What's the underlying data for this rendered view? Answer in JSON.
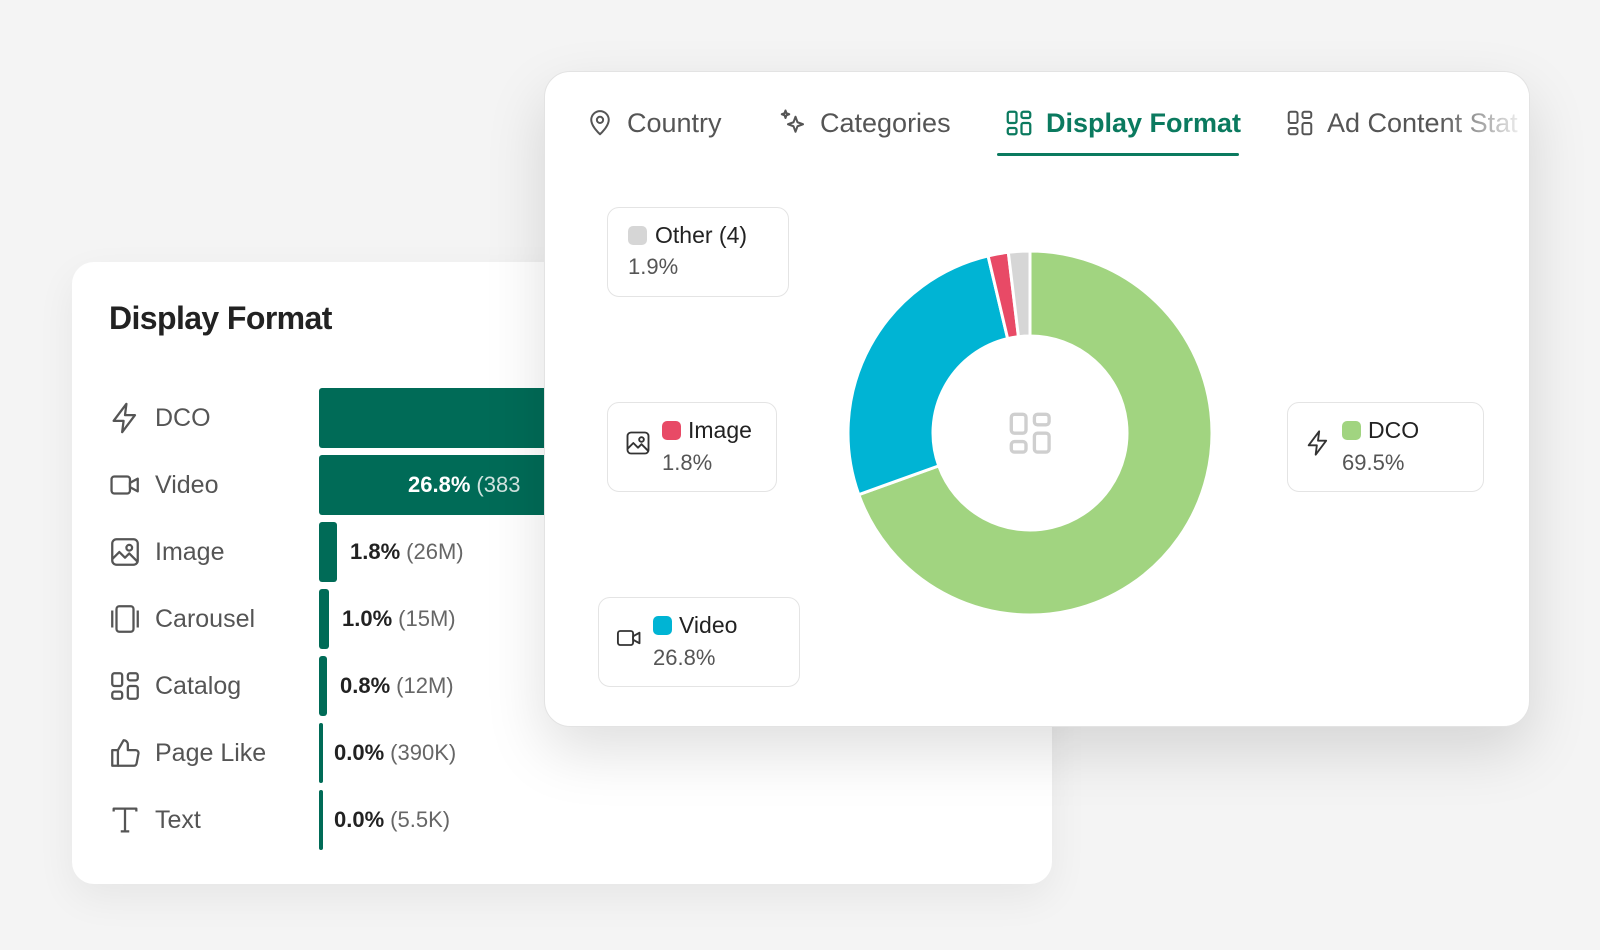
{
  "back_card": {
    "title": "Display Format"
  },
  "front_card": {
    "tabs": [
      {
        "label": "Country",
        "icon": "map-pin-icon",
        "active": false
      },
      {
        "label": "Categories",
        "icon": "sparkles-icon",
        "active": false
      },
      {
        "label": "Display Format",
        "icon": "layout-grid-icon",
        "active": true
      },
      {
        "label": "Ad Content Stat",
        "icon": "layout-grid-icon",
        "active": false
      }
    ]
  },
  "colors": {
    "accent": "#0b7a5f",
    "bar": "#006b57",
    "dco": "#a1d480",
    "video": "#00b4d4",
    "image": "#e84a66",
    "other": "#d6d6d6"
  },
  "chart_data": [
    {
      "type": "bar",
      "orientation": "horizontal",
      "title": "Display Format",
      "categories": [
        "DCO",
        "Video",
        "Image",
        "Carousel",
        "Catalog",
        "Page Like",
        "Text"
      ],
      "values": [
        69.5,
        26.8,
        1.8,
        1.0,
        0.8,
        0.0,
        0.0
      ],
      "pct_labels": [
        "",
        "26.8%",
        "1.8%",
        "1.0%",
        "0.8%",
        "0.0%",
        "0.0%"
      ],
      "abs_labels": [
        "",
        "(383",
        "(26M)",
        "(15M)",
        "(12M)",
        "(390K)",
        "(5.5K)"
      ],
      "icons": [
        "zap-icon",
        "video-icon",
        "image-icon",
        "carousel-icon",
        "catalog-icon",
        "thumbs-up-icon",
        "text-icon"
      ]
    },
    {
      "type": "pie",
      "donut": true,
      "center_icon": "layout-grid-icon",
      "slices": [
        {
          "label": "DCO",
          "value": 69.5,
          "pct_label": "69.5%",
          "color": "#a1d480",
          "icon": "zap-icon"
        },
        {
          "label": "Video",
          "value": 26.8,
          "pct_label": "26.8%",
          "color": "#00b4d4",
          "icon": "video-icon"
        },
        {
          "label": "Image",
          "value": 1.8,
          "pct_label": "1.8%",
          "color": "#e84a66",
          "icon": "image-icon"
        },
        {
          "label": "Other (4)",
          "value": 1.9,
          "pct_label": "1.9%",
          "color": "#d6d6d6",
          "icon": ""
        }
      ]
    }
  ]
}
